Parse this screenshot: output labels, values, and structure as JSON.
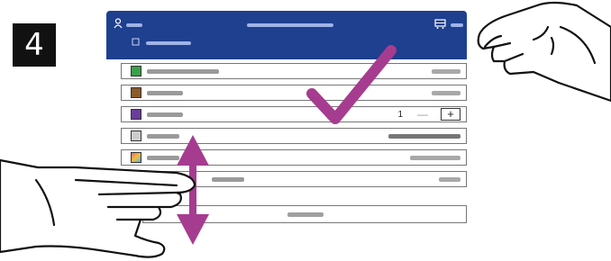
{
  "step": {
    "number": "4"
  },
  "header": {
    "left_icon": "user-icon",
    "left_label": "",
    "title": "",
    "subtitle": "",
    "right_icon": "cart-icon",
    "right_label": "",
    "background": "#1f3f8f"
  },
  "items": [
    {
      "icon": "green-app-icon",
      "icon_color": "#3aa04a",
      "name": "",
      "detail": ""
    },
    {
      "icon": "brown-app-icon",
      "icon_color": "#8a5a2b",
      "name": "",
      "detail": ""
    },
    {
      "icon": "purple-app-icon",
      "icon_color": "#6a3d9a",
      "name": "",
      "quantity": "1",
      "minus": "—",
      "plus": "+"
    },
    {
      "icon": "scan-app-icon",
      "icon_color": "#cccccc",
      "name": "",
      "detail": ""
    },
    {
      "icon": "colorful-app-icon",
      "icon_color": "#f0c040",
      "name": "",
      "detail": ""
    },
    {
      "icon": "generic-app-icon",
      "icon_color": "#dddddd",
      "name": "",
      "detail": ""
    }
  ],
  "action": {
    "label": ""
  },
  "overlay": {
    "checkmark_color": "#a63c8f",
    "scroll_arrow_color": "#a63c8f",
    "checkmark_icon": "checkmark-icon",
    "scroll_icon": "scroll-up-down-icon",
    "hand_icon": "hand-icon"
  }
}
